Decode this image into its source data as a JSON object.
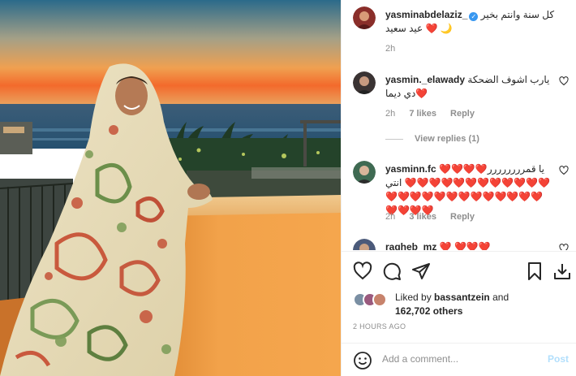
{
  "post": {
    "author": "yasminabdelaziz_",
    "verified": true,
    "caption": "كل سنة وانتم بخير ❤️ عيد سعيد 🌙",
    "time": "2h"
  },
  "comments": [
    {
      "username": "yasmin._elawady",
      "text": "يارب اشوف الضحكة دي ديما❤️",
      "time": "2h",
      "likes": "7 likes",
      "reply_label": "Reply",
      "view_replies": "View replies (1)"
    },
    {
      "username": "yasminn.fc",
      "text": "❤️❤️❤️❤️يا قمرررررررر انتي ❤️❤️❤️❤️❤️❤️❤️❤️❤️❤️❤️❤️❤️❤️❤️❤️❤️❤️❤️❤️❤️❤️❤️❤️❤️❤️❤️❤️❤️",
      "time": "2h",
      "likes": "3 likes",
      "reply_label": "Reply"
    },
    {
      "username": "ragheb_mz",
      "text": "❤️ ❤️❤️❤️"
    }
  ],
  "likes": {
    "prefix": "Liked by",
    "user": "bassantzein",
    "joiner": "and",
    "count": "162,702 others"
  },
  "posted_ago": "2 HOURS AGO",
  "composer": {
    "placeholder": "Add a comment...",
    "post_label": "Post"
  },
  "colors": {
    "accent_blue": "#3897f0",
    "post_disabled": "#b2dffc",
    "muted": "#8e8e8e"
  },
  "icons": [
    "heart-icon",
    "comment-icon",
    "share-icon",
    "bookmark-icon",
    "download-icon",
    "emoji-icon",
    "verified-icon"
  ]
}
